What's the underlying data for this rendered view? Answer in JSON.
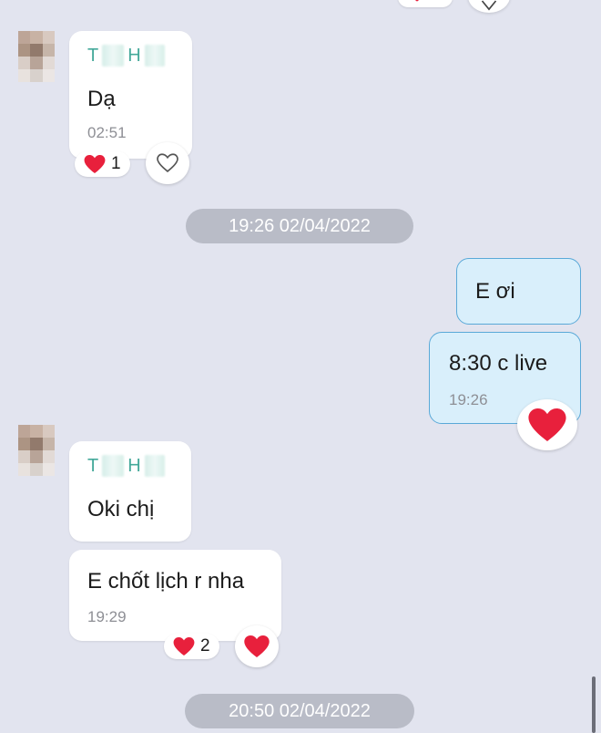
{
  "colors": {
    "background": "#e2e4ef",
    "incoming_bubble": "#ffffff",
    "outgoing_bubble": "#d9effb",
    "outgoing_border": "#5aa9d8",
    "sender_name": "#44a99a",
    "date_pill": "#b9bcc7",
    "heart": "#e8203c"
  },
  "messages": {
    "group1": {
      "sender": {
        "initial_1": "T",
        "initial_2": "H"
      },
      "text": "Dạ",
      "time": "02:51",
      "reaction": {
        "icon": "heart-icon",
        "count": "1"
      },
      "reaction_button_icon": "heart-outline-icon"
    },
    "divider1": {
      "label": "19:26 02/04/2022"
    },
    "outgoing": {
      "msg1": "E ơi",
      "msg2": "8:30 c live",
      "time": "19:26",
      "reaction_button_icon": "heart-filled-icon"
    },
    "group2": {
      "sender": {
        "initial_1": "T",
        "initial_2": "H"
      },
      "msg1": "Oki chị",
      "msg2": "E chốt lịch r nha",
      "time": "19:29",
      "reaction": {
        "icon": "heart-icon",
        "count": "2"
      },
      "reaction_button_icon": "heart-filled-icon"
    },
    "divider2": {
      "label": "20:50 02/04/2022"
    }
  }
}
